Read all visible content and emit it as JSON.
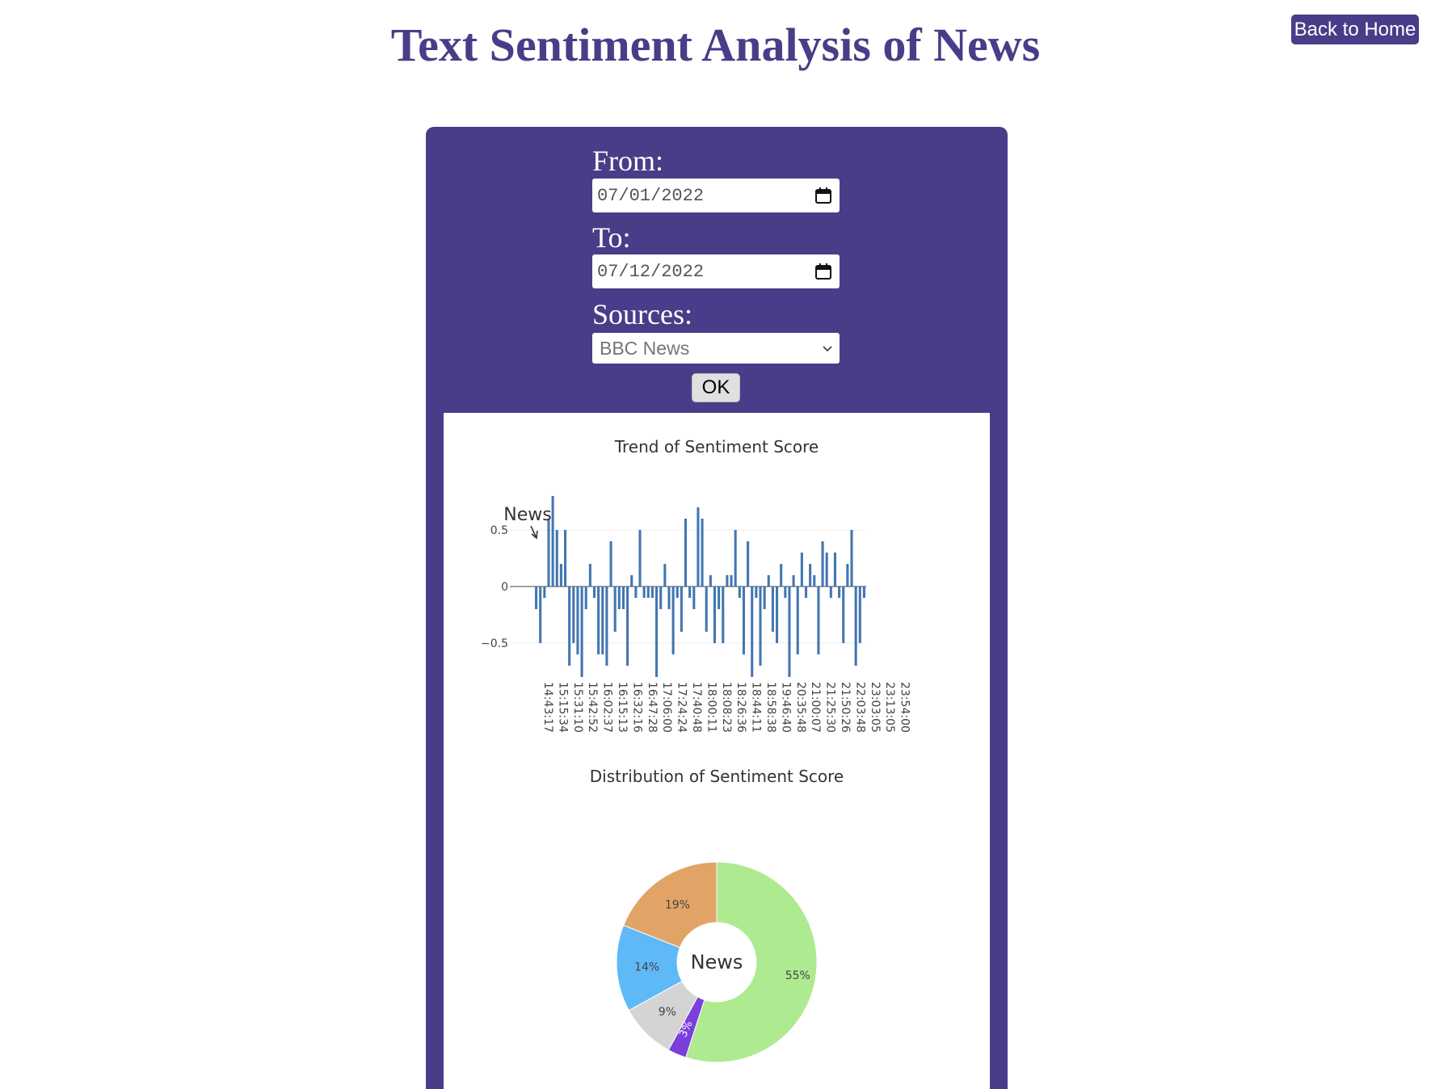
{
  "header": {
    "title": "Text Sentiment Analysis of News",
    "back_label": "Back to Home"
  },
  "form": {
    "from_label": "From:",
    "from_value": "07/01/2022",
    "to_label": "To:",
    "to_value": "07/12/2022",
    "sources_label": "Sources:",
    "sources_value": "BBC News",
    "ok_label": "OK"
  },
  "colors": {
    "brand": "#483d88",
    "bar": "#4276b1",
    "positive": "#aeea90",
    "negative": "#e2a466",
    "neutral_blue": "#5fb9f7",
    "neutral_gray": "#d4d4d4",
    "purple": "#7b3fdb"
  },
  "chart_data": [
    {
      "type": "bar",
      "title": "Trend of Sentiment Score",
      "annotation": "News",
      "yticks": [
        "0.5",
        "0",
        "−0.5"
      ],
      "ylim": [
        -0.8,
        0.8
      ],
      "xticks": [
        "14:43:17",
        "15:15:34",
        "15:31:10",
        "15:42:52",
        "16:02:37",
        "16:15:13",
        "16:32:16",
        "16:47:28",
        "17:06:00",
        "17:24:24",
        "17:40:48",
        "18:00:11",
        "18:08:23",
        "18:26:36",
        "18:44:11",
        "18:58:38",
        "19:46:40",
        "20:35:48",
        "21:00:07",
        "21:25:30",
        "21:50:26",
        "22:03:48",
        "23:03:05",
        "23:13:05",
        "23:54:00"
      ],
      "values": [
        -0.2,
        -0.5,
        -0.1,
        0.6,
        0.8,
        0.5,
        0.2,
        0.5,
        -0.7,
        -0.5,
        -0.6,
        -0.8,
        -0.2,
        0.2,
        -0.1,
        -0.6,
        -0.6,
        -0.7,
        0.4,
        -0.4,
        -0.2,
        -0.2,
        -0.7,
        0.1,
        -0.1,
        0.5,
        -0.1,
        -0.1,
        -0.1,
        -0.8,
        -0.2,
        0.2,
        -0.2,
        -0.6,
        -0.1,
        -0.4,
        0.6,
        -0.1,
        -0.2,
        0.7,
        0.6,
        -0.4,
        0.1,
        -0.5,
        -0.2,
        -0.5,
        0.1,
        0.1,
        0.5,
        -0.1,
        -0.6,
        0.4,
        -0.8,
        -0.1,
        -0.7,
        -0.2,
        0.1,
        -0.4,
        -0.5,
        0.2,
        -0.1,
        -0.8,
        0.1,
        -0.6,
        0.3,
        -0.1,
        0.2,
        0.1,
        -0.6,
        0.4,
        0.3,
        -0.1,
        0.3,
        -0.1,
        -0.5,
        0.2,
        0.5,
        -0.7,
        -0.5,
        -0.1
      ]
    },
    {
      "type": "pie",
      "title": "Distribution of Sentiment Score",
      "center_label": "News",
      "slices": [
        {
          "label": "55%",
          "value": 55,
          "color": "#aeea90"
        },
        {
          "label": "3%",
          "value": 3,
          "color": "#7b3fdb"
        },
        {
          "label": "9%",
          "value": 9,
          "color": "#d4d4d4"
        },
        {
          "label": "14%",
          "value": 14,
          "color": "#5fb9f7"
        },
        {
          "label": "19%",
          "value": 19,
          "color": "#e2a466"
        }
      ]
    }
  ]
}
